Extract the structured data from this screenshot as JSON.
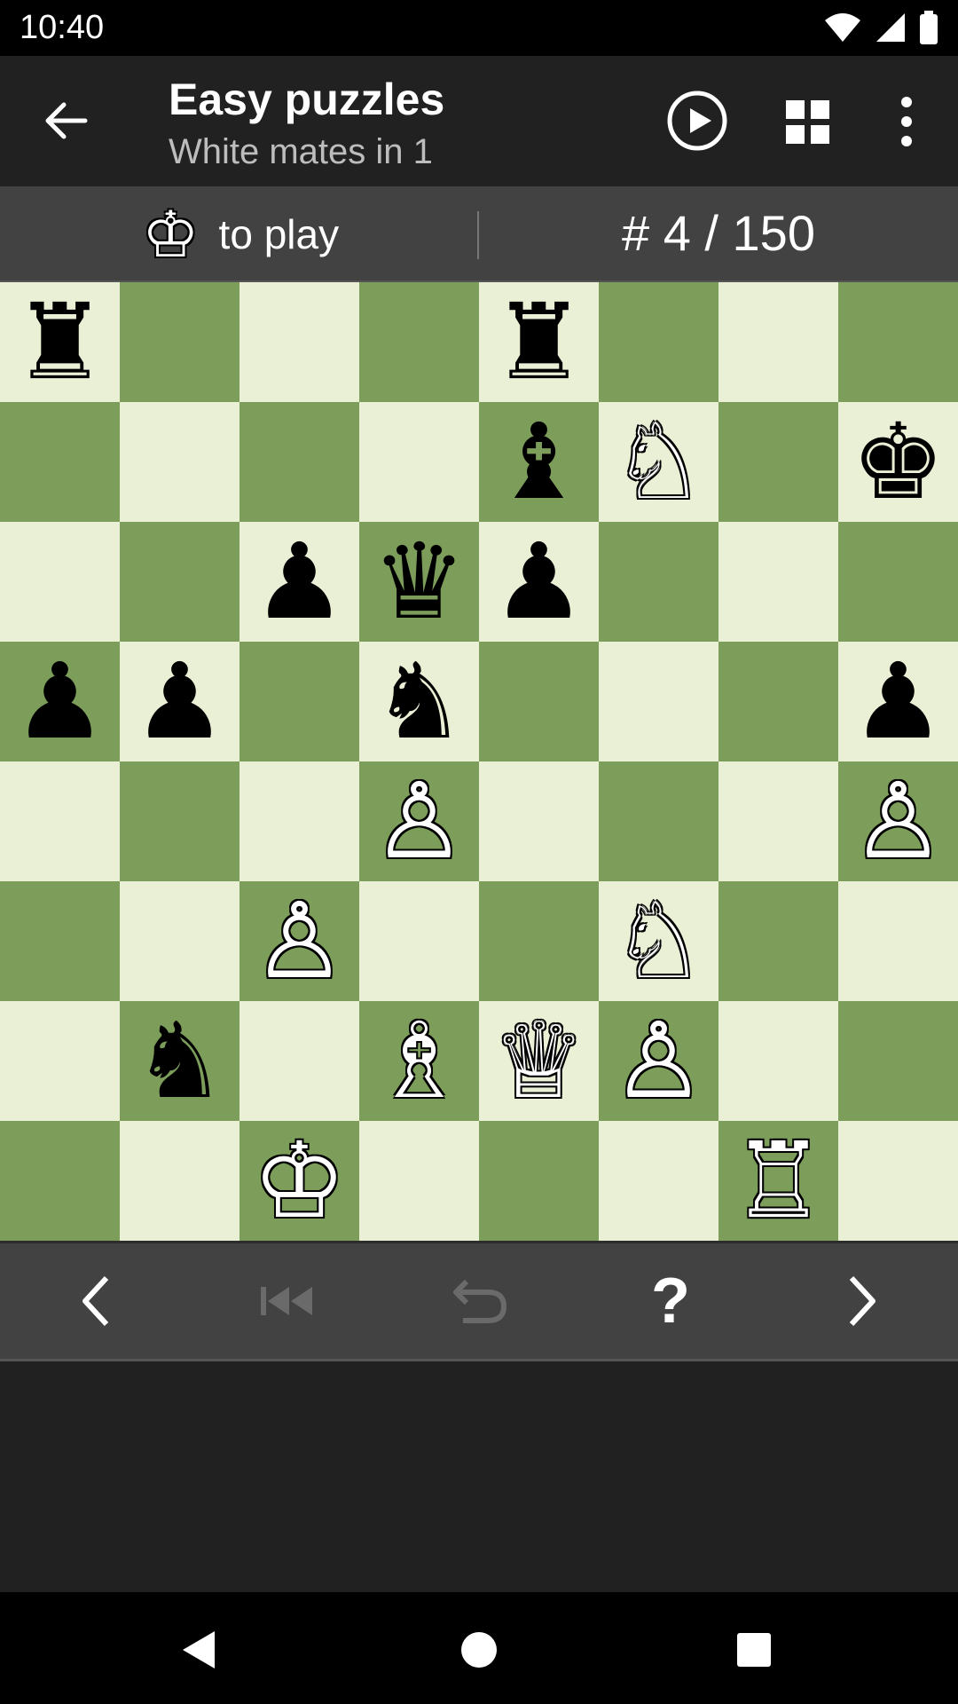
{
  "status_bar": {
    "time": "10:40"
  },
  "app_bar": {
    "title": "Easy puzzles",
    "subtitle": "White mates in 1",
    "icons": [
      "arrow-back-icon",
      "play-circle-icon",
      "grid-icon",
      "more-vert-icon"
    ]
  },
  "info_bar": {
    "turn_piece": "♔",
    "turn_text": "to play",
    "counter": "# 4 / 150"
  },
  "board": {
    "light_color": "#eaf0d6",
    "dark_color": "#7c9e5a",
    "ranks": [
      [
        "r",
        "",
        "",
        "",
        "r",
        "",
        "",
        ""
      ],
      [
        "",
        "",
        "",
        "",
        "b",
        "N",
        "",
        "k"
      ],
      [
        "",
        "",
        "p",
        "q",
        "p",
        "",
        "",
        ""
      ],
      [
        "p",
        "p",
        "",
        "n",
        "",
        "",
        "",
        "p"
      ],
      [
        "",
        "",
        "",
        "P",
        "",
        "",
        "",
        "P"
      ],
      [
        "",
        "",
        "P",
        "",
        "",
        "N",
        "",
        ""
      ],
      [
        "",
        "n",
        "",
        "B",
        "Q",
        "P",
        "",
        ""
      ],
      [
        "",
        "",
        "K",
        "",
        "",
        "",
        "R",
        ""
      ]
    ]
  },
  "controls": {
    "buttons": [
      {
        "name": "previous-puzzle-button",
        "icon": "chevron-left-icon",
        "enabled": true
      },
      {
        "name": "first-move-button",
        "icon": "skip-back-icon",
        "enabled": false
      },
      {
        "name": "undo-button",
        "icon": "undo-icon",
        "enabled": false
      },
      {
        "name": "hint-button",
        "icon": "question-mark-icon",
        "enabled": true,
        "label": "?"
      },
      {
        "name": "next-puzzle-button",
        "icon": "chevron-right-icon",
        "enabled": true
      }
    ]
  },
  "system_nav": {
    "icons": [
      "back-triangle-icon",
      "home-circle-icon",
      "recents-square-icon"
    ]
  }
}
